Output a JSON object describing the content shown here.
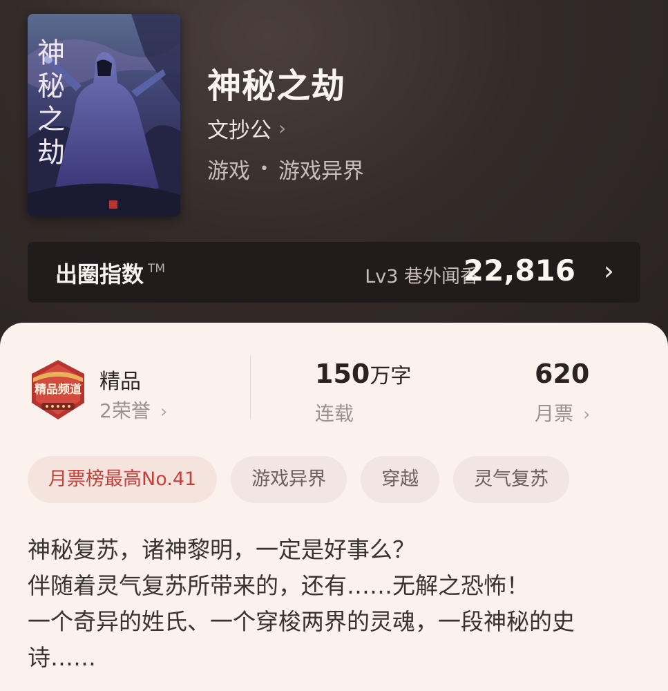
{
  "book": {
    "title": "神秘之劫",
    "author": "文抄公",
    "genre": "游戏",
    "subgenre": "游戏异界",
    "cover_text": "神秘之劫"
  },
  "index": {
    "label": "出圈指数",
    "tm": "TM",
    "level": "Lv3 巷外闻香",
    "value": "22,816"
  },
  "stats": {
    "quality_label": "精品",
    "honor_count": "2荣誉",
    "badge_text": "精品频道",
    "words_number": "150",
    "words_unit": "万字",
    "status": "连载",
    "monthly_votes": "620",
    "monthly_votes_label": "月票"
  },
  "tags": [
    "月票榜最高No.41",
    "游戏异界",
    "穿越",
    "灵气复苏"
  ],
  "synopsis": [
    "神秘复苏，诸神黎明，一定是好事么？",
    "伴随着灵气复苏所带来的，还有……无解之恐怖！",
    "一个奇异的姓氏、一个穿梭两界的灵魂，一段神秘的史诗……"
  ],
  "colors": {
    "accent": "#c2413b",
    "dark_bg": "#2a2322",
    "panel_bg": "#fbf2ed"
  }
}
